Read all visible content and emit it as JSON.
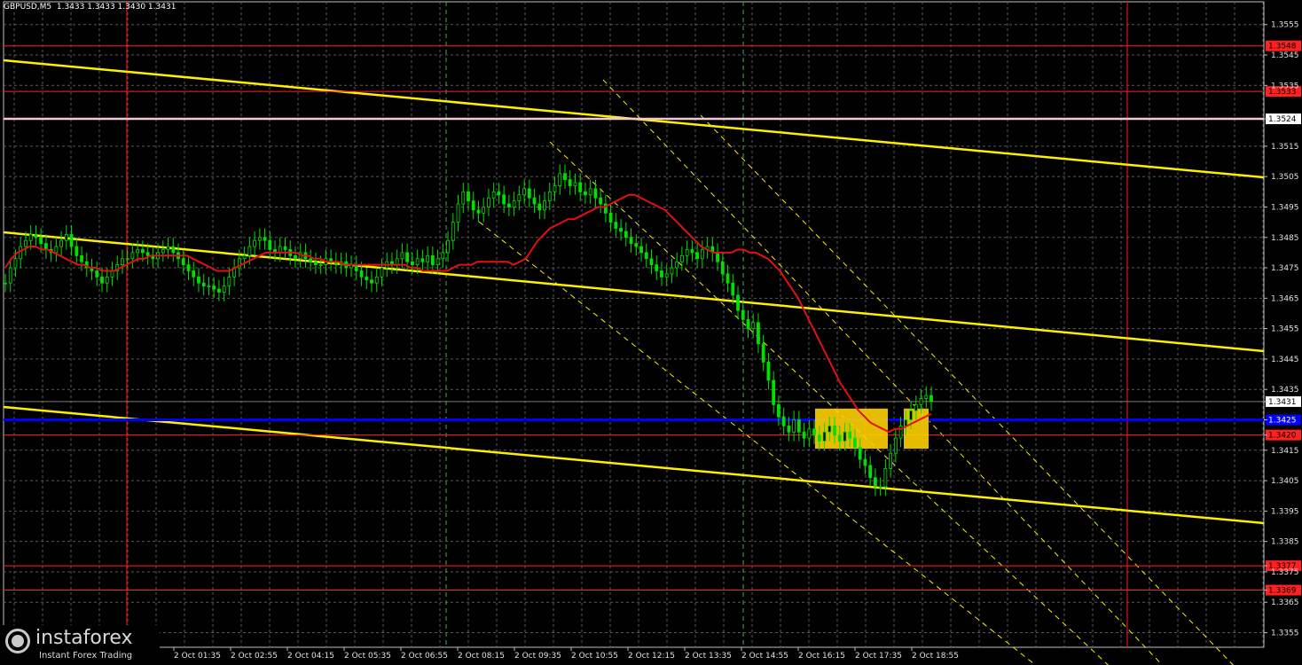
{
  "header": {
    "text": "GBPUSD,M5  1.3433 1.3433 1.3430 1.3431"
  },
  "watermark": {
    "brand": "instaforex",
    "tagline": "Instant Forex Trading"
  },
  "chart_data": {
    "type": "candlestick",
    "symbol": "GBPUSD",
    "timeframe": "M5",
    "ohlc": {
      "open": 1.3433,
      "high": 1.3433,
      "low": 1.343,
      "close": 1.3431
    },
    "ylim": [
      1.3349,
      1.3563
    ],
    "y_ticks": [
      "1.3555",
      "1.3545",
      "1.3535",
      "1.3524",
      "1.3515",
      "1.3505",
      "1.3495",
      "1.3485",
      "1.3475",
      "1.3465",
      "1.3455",
      "1.3445",
      "1.3435",
      "1.3431",
      "1.3425",
      "1.3420",
      "1.3415",
      "1.3405",
      "1.3395",
      "1.3385",
      "1.3377",
      "1.3375",
      "1.3369",
      "1.3365",
      "1.3355"
    ],
    "x_ticks": [
      "2 Oct 01:35",
      "2 Oct 02:55",
      "2 Oct 04:15",
      "2 Oct 05:35",
      "2 Oct 06:55",
      "2 Oct 08:15",
      "2 Oct 09:35",
      "2 Oct 10:55",
      "2 Oct 12:15",
      "2 Oct 13:35",
      "2 Oct 14:55",
      "2 Oct 16:15",
      "2 Oct 17:35",
      "2 Oct 18:55"
    ],
    "levels": [
      {
        "price": 1.3548,
        "label": "1.3548",
        "color": "#ff2020",
        "style": "red"
      },
      {
        "price": 1.3533,
        "label": "1.3533",
        "color": "#ff2020",
        "style": "red"
      },
      {
        "price": 1.3524,
        "label": "1.3524",
        "color": "#f0c8d8",
        "style": "pink"
      },
      {
        "price": 1.3431,
        "label": "1.3431",
        "color": "#808080",
        "style": "current"
      },
      {
        "price": 1.3425,
        "label": "1.3425",
        "color": "#0000ff",
        "style": "blue"
      },
      {
        "price": 1.342,
        "label": "1.3420",
        "color": "#ff2020",
        "style": "red"
      },
      {
        "price": 1.3377,
        "label": "1.3377",
        "color": "#ff2020",
        "style": "red"
      },
      {
        "price": 1.3369,
        "label": "1.3369",
        "color": "#ff2020",
        "style": "red"
      }
    ],
    "close_series": [
      1.347,
      1.3475,
      1.3478,
      1.3482,
      1.3484,
      1.3486,
      1.3485,
      1.3483,
      1.3481,
      1.348,
      1.3482,
      1.3484,
      1.3486,
      1.3482,
      1.3479,
      1.3477,
      1.3475,
      1.3474,
      1.3472,
      1.347,
      1.3472,
      1.3474,
      1.3476,
      1.3478,
      1.3478,
      1.348,
      1.3481,
      1.348,
      1.3479,
      1.3478,
      1.348,
      1.3481,
      1.3482,
      1.348,
      1.3478,
      1.3476,
      1.3474,
      1.3472,
      1.347,
      1.3469,
      1.3469,
      1.3468,
      1.3467,
      1.3469,
      1.3472,
      1.3475,
      1.3478,
      1.3479,
      1.3482,
      1.3484,
      1.3485,
      1.3484,
      1.3481,
      1.348,
      1.3482,
      1.3481,
      1.3479,
      1.3478,
      1.348,
      1.3478,
      1.3477,
      1.3476,
      1.3476,
      1.3478,
      1.3477,
      1.3476,
      1.3477,
      1.3475,
      1.3476,
      1.3474,
      1.3472,
      1.3471,
      1.347,
      1.3472,
      1.3475,
      1.3477,
      1.3476,
      1.3478,
      1.348,
      1.3477,
      1.3476,
      1.3478,
      1.3477,
      1.3479,
      1.3476,
      1.3478,
      1.348,
      1.3484,
      1.349,
      1.3496,
      1.35,
      1.3497,
      1.3494,
      1.3493,
      1.3495,
      1.3498,
      1.35,
      1.3499,
      1.3496,
      1.3495,
      1.3497,
      1.3499,
      1.3501,
      1.3498,
      1.3496,
      1.3494,
      1.3497,
      1.35,
      1.3502,
      1.3506,
      1.3504,
      1.3502,
      1.3503,
      1.35,
      1.3499,
      1.3501,
      1.3498,
      1.3496,
      1.3493,
      1.349,
      1.3488,
      1.3487,
      1.3485,
      1.3483,
      1.3482,
      1.348,
      1.3478,
      1.3476,
      1.3474,
      1.3472,
      1.3473,
      1.3475,
      1.3477,
      1.3479,
      1.3481,
      1.348,
      1.3478,
      1.3481,
      1.3482,
      1.348,
      1.3477,
      1.3473,
      1.347,
      1.3466,
      1.3461,
      1.3458,
      1.3455,
      1.3457,
      1.345,
      1.3444,
      1.3438,
      1.343,
      1.3426,
      1.3423,
      1.3421,
      1.3425,
      1.3421,
      1.3419,
      1.3422,
      1.342,
      1.3418,
      1.3421,
      1.3423,
      1.342,
      1.3418,
      1.3421,
      1.3419,
      1.3416,
      1.3412,
      1.341,
      1.3406,
      1.3403,
      1.3403,
      1.3409,
      1.3414,
      1.3419,
      1.3423,
      1.3425,
      1.3428,
      1.343,
      1.3432,
      1.3433,
      1.3431
    ],
    "ma_series": [
      1.3475,
      1.3478,
      1.348,
      1.3481,
      1.3482,
      1.3482,
      1.3481,
      1.3481,
      1.348,
      1.3479,
      1.3478,
      1.3477,
      1.3476,
      1.3476,
      1.3475,
      1.3475,
      1.3474,
      1.3474,
      1.3474,
      1.3475,
      1.3476,
      1.3477,
      1.3478,
      1.3478,
      1.3479,
      1.3479,
      1.3479,
      1.3479,
      1.3479,
      1.3479,
      1.3479,
      1.3478,
      1.3477,
      1.3476,
      1.3475,
      1.3474,
      1.3474,
      1.3474,
      1.3475,
      1.3476,
      1.3477,
      1.3478,
      1.3479,
      1.348,
      1.348,
      1.348,
      1.348,
      1.348,
      1.348,
      1.3479,
      1.3479,
      1.3478,
      1.3478,
      1.3477,
      1.3477,
      1.3477,
      1.3476,
      1.3476,
      1.3476,
      1.3476,
      1.3476,
      1.3476,
      1.3476,
      1.3476,
      1.3476,
      1.3476,
      1.3476,
      1.3475,
      1.3475,
      1.3474,
      1.3474,
      1.3474,
      1.3474,
      1.3474,
      1.3475,
      1.3476,
      1.3476,
      1.3476,
      1.3477,
      1.3477,
      1.3477,
      1.3477,
      1.3477,
      1.3477,
      1.3476,
      1.3477,
      1.3478,
      1.3481,
      1.3484,
      1.3486,
      1.3488,
      1.3489,
      1.349,
      1.3491,
      1.3491,
      1.3492,
      1.3493,
      1.3494,
      1.3495,
      1.3495,
      1.3496,
      1.3497,
      1.3498,
      1.3499,
      1.3499,
      1.3498,
      1.3497,
      1.3496,
      1.3495,
      1.3494,
      1.3492,
      1.349,
      1.3488,
      1.3486,
      1.3484,
      1.3482,
      1.3481,
      1.348,
      1.348,
      1.348,
      1.348,
      1.3481,
      1.3481,
      1.348,
      1.348,
      1.3479,
      1.3478,
      1.3476,
      1.3474,
      1.3471,
      1.3468,
      1.3465,
      1.3461,
      1.3457,
      1.3453,
      1.3449,
      1.3445,
      1.3441,
      1.3437,
      1.3434,
      1.3431,
      1.3428,
      1.3426,
      1.3424,
      1.3423,
      1.3422,
      1.3421,
      1.3422,
      1.3422,
      1.3423,
      1.3424,
      1.3425,
      1.3426,
      1.3427
    ]
  }
}
